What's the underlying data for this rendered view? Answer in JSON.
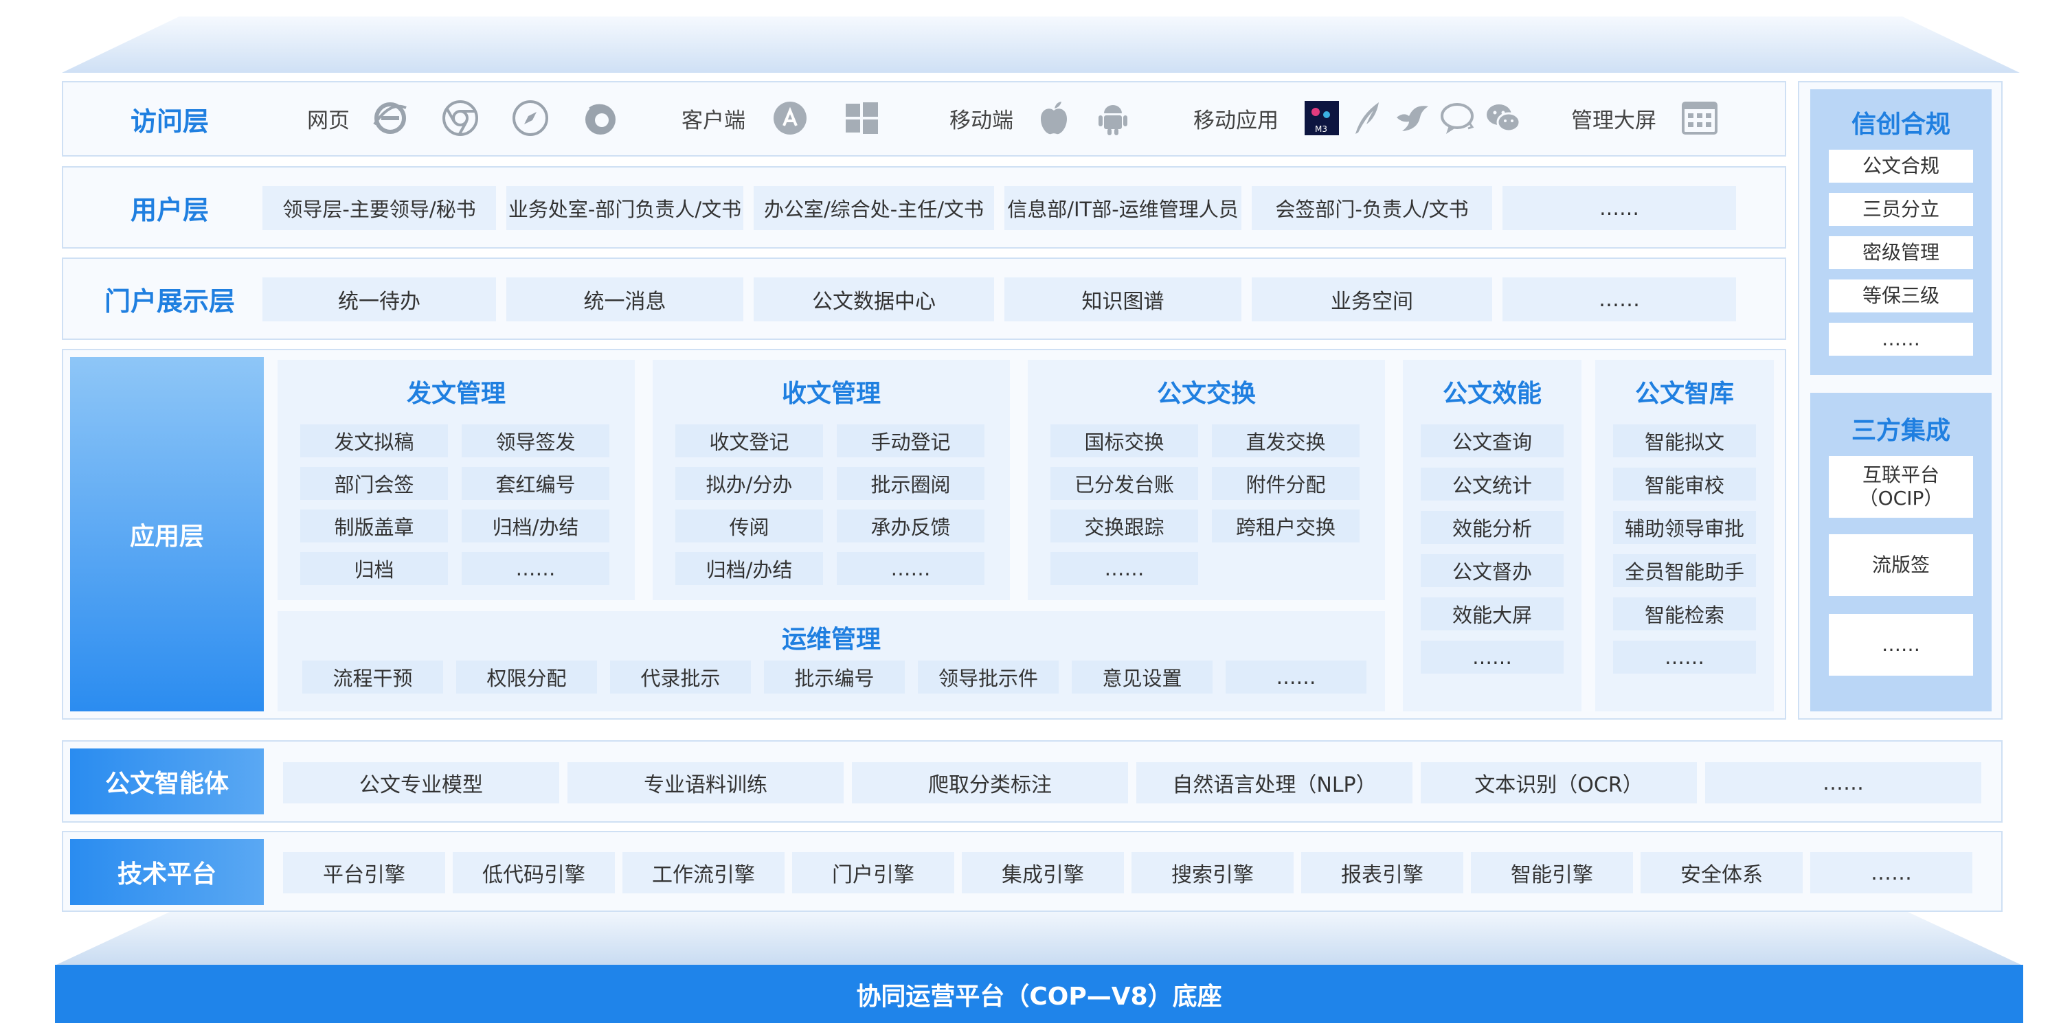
{
  "access_layer": {
    "title": "访问层",
    "groups": [
      {
        "label": "网页",
        "icons": [
          "ie-icon",
          "chrome-icon",
          "safari-icon",
          "firefox-icon"
        ]
      },
      {
        "label": "客户端",
        "icons": [
          "appstore-icon",
          "windows-icon"
        ]
      },
      {
        "label": "移动端",
        "icons": [
          "apple-icon",
          "android-icon"
        ]
      },
      {
        "label": "移动应用",
        "icons": [
          "m-app-icon",
          "feather-icon",
          "bird-icon",
          "chat-bubble-icon",
          "wechat-icon"
        ]
      },
      {
        "label": "管理大屏",
        "icons": [
          "dashboard-screen-icon"
        ]
      }
    ]
  },
  "user_layer": {
    "title": "用户层",
    "items": [
      "领导层-主要领导/秘书",
      "业务处室-部门负责人/文书",
      "办公室/综合处-主任/文书",
      "信息部/IT部-运维管理人员",
      "会签部门-负责人/文书",
      "……"
    ]
  },
  "portal_layer": {
    "title": "门户展示层",
    "items": [
      "统一待办",
      "统一消息",
      "公文数据中心",
      "知识图谱",
      "业务空间",
      "……"
    ]
  },
  "app_layer": {
    "title": "应用层",
    "modules": [
      {
        "title": "发文管理",
        "items": [
          "发文拟稿",
          "领导签发",
          "部门会签",
          "套红编号",
          "制版盖章",
          "归档/办结",
          "归档",
          "……"
        ]
      },
      {
        "title": "收文管理",
        "items": [
          "收文登记",
          "手动登记",
          "拟办/分办",
          "批示圈阅",
          "传阅",
          "承办反馈",
          "归档/办结",
          "……"
        ]
      },
      {
        "title": "公文交换",
        "items": [
          "国标交换",
          "直发交换",
          "已分发台账",
          "附件分配",
          "交换跟踪",
          "跨租户交换",
          "……"
        ]
      },
      {
        "title": "公文效能",
        "items": [
          "公文查询",
          "公文统计",
          "效能分析",
          "公文督办",
          "效能大屏",
          "……"
        ]
      },
      {
        "title": "公文智库",
        "items": [
          "智能拟文",
          "智能审校",
          "辅助领导审批",
          "全员智能助手",
          "智能检索",
          "……"
        ]
      }
    ],
    "ops": {
      "title": "运维管理",
      "items": [
        "流程干预",
        "权限分配",
        "代录批示",
        "批示编号",
        "领导批示件",
        "意见设置",
        "……"
      ]
    }
  },
  "side": {
    "compliance": {
      "title": "信创合规",
      "items": [
        "公文合规",
        "三员分立",
        "密级管理",
        "等保三级",
        "……"
      ]
    },
    "integration": {
      "title": "三方集成",
      "items": [
        "互联平台\n（OCIP）",
        "流版签",
        "……"
      ]
    }
  },
  "agent_layer": {
    "title": "公文智能体",
    "items": [
      "公文专业模型",
      "专业语料训练",
      "爬取分类标注",
      "自然语言处理（NLP）",
      "文本识别（OCR）",
      "……"
    ]
  },
  "tech_layer": {
    "title": "技术平台",
    "items": [
      "平台引擎",
      "低代码引擎",
      "工作流引擎",
      "门户引擎",
      "集成引擎",
      "搜索引擎",
      "报表引擎",
      "智能引擎",
      "安全体系",
      "……"
    ]
  },
  "base": {
    "title": "协同运营平台（COP—V8）底座"
  },
  "colors": {
    "accent": "#1f7fe0",
    "base_bar": "#1f84ea",
    "cell_bg": "#e6f0fc",
    "border": "#cfe0f4"
  }
}
